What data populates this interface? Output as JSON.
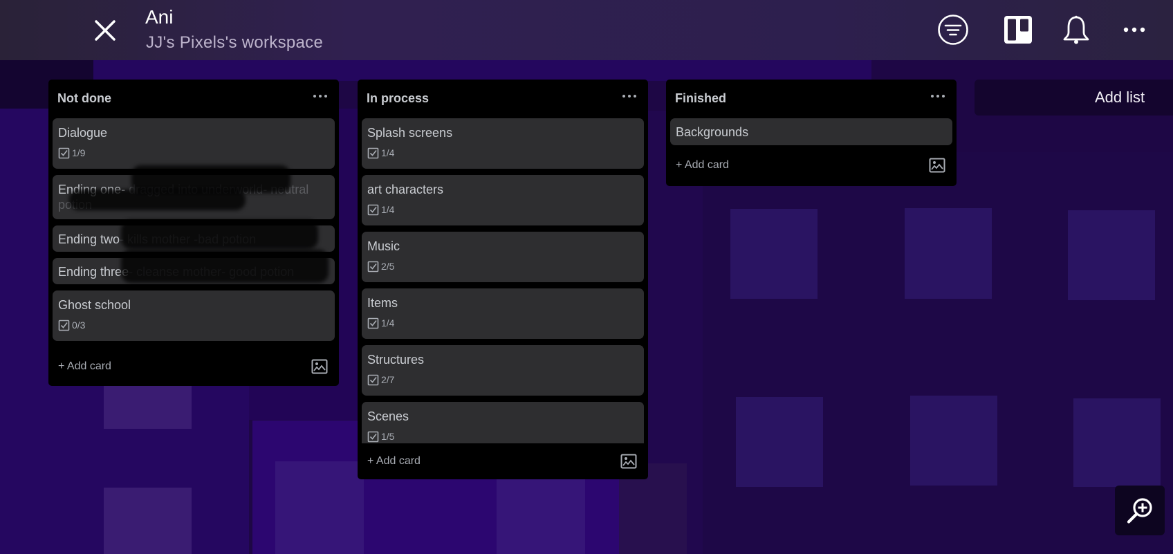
{
  "header": {
    "board_title": "Ani",
    "workspace_name": "JJ's Pixels's workspace",
    "icons": {
      "close": "close-icon",
      "filter": "filter-icon",
      "board_view": "board-view-icon",
      "notifications": "bell-icon",
      "more": "more-icon"
    }
  },
  "lists": [
    {
      "title": "Not done",
      "cards": [
        {
          "title": "Dialogue",
          "checklist": "1/9"
        },
        {
          "title_visible": "Ending one-",
          "title_hidden": " dragged into underworld- neutral potion",
          "redacted": true
        },
        {
          "title_visible": "Ending two",
          "title_hidden": "- kills mother -bad potion",
          "redacted": true
        },
        {
          "title_visible": "Ending three",
          "title_hidden": "- cleanse mother- good potion",
          "redacted": true
        },
        {
          "title": "Ghost school",
          "checklist": "0/3"
        }
      ],
      "add_card_label": "+ Add card"
    },
    {
      "title": "In process",
      "cards": [
        {
          "title": "Splash screens",
          "checklist": "1/4"
        },
        {
          "title": "art characters",
          "checklist": "1/4"
        },
        {
          "title": "Music",
          "checklist": "2/5"
        },
        {
          "title": "Items",
          "checklist": "1/4"
        },
        {
          "title": "Structures",
          "checklist": "2/7"
        },
        {
          "title": "Scenes",
          "checklist": "1/5"
        }
      ],
      "add_card_label": "+ Add card"
    },
    {
      "title": "Finished",
      "cards": [
        {
          "title": "Backgrounds"
        }
      ],
      "add_card_label": "+ Add card"
    }
  ],
  "add_list_label": "Add list",
  "colors": {
    "board_background": "#1d0745",
    "list_background": "#000000",
    "card_background": "#2e2e30",
    "card_text": "#c9ccd1"
  }
}
